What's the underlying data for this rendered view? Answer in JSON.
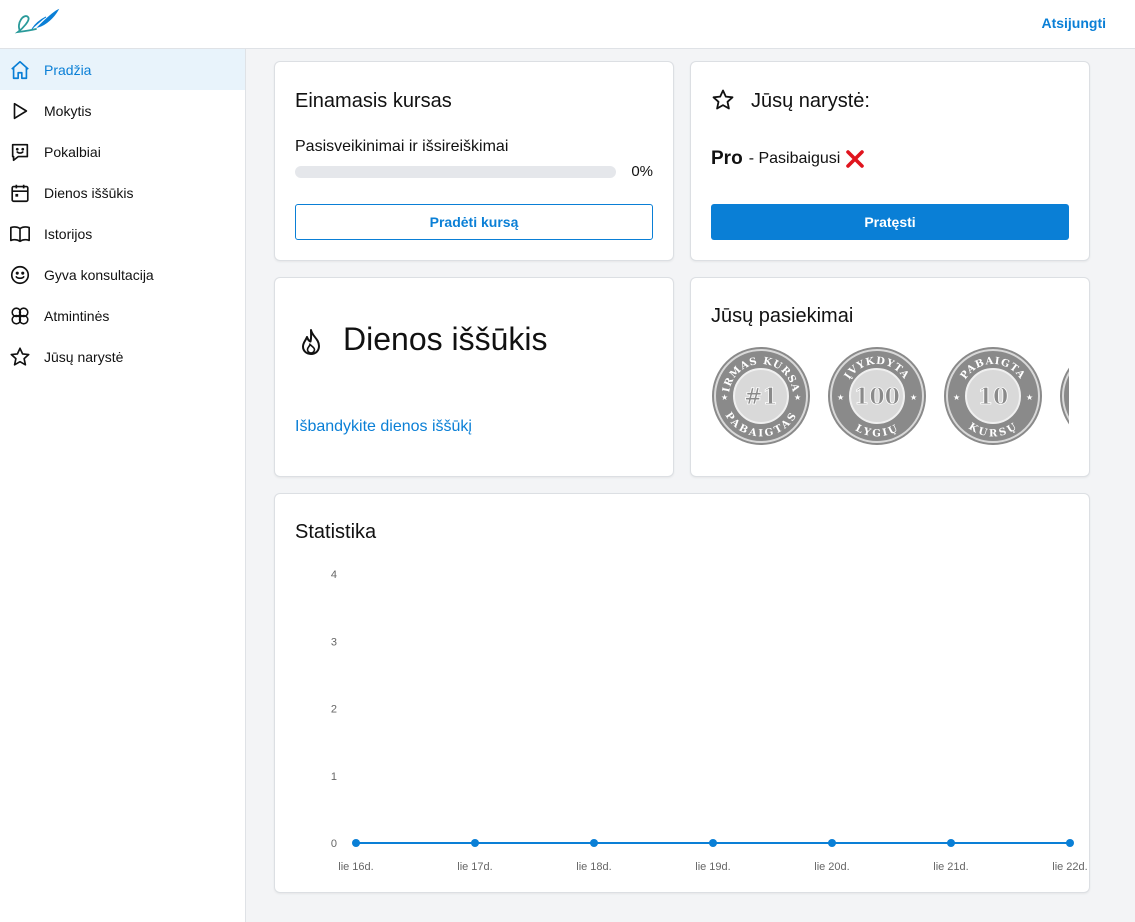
{
  "header": {
    "logout_label": "Atsijungti"
  },
  "sidebar": {
    "items": [
      {
        "label": "Pradžia",
        "icon": "home-icon",
        "active": true
      },
      {
        "label": "Mokytis",
        "icon": "play-icon"
      },
      {
        "label": "Pokalbiai",
        "icon": "chat-icon"
      },
      {
        "label": "Dienos iššūkis",
        "icon": "calendar-icon"
      },
      {
        "label": "Istorijos",
        "icon": "book-icon"
      },
      {
        "label": "Gyva konsultacija",
        "icon": "smiley-icon"
      },
      {
        "label": "Atmintinės",
        "icon": "brain-icon"
      },
      {
        "label": "Jūsų narystė",
        "icon": "star-icon"
      }
    ]
  },
  "course": {
    "title": "Einamasis kursas",
    "name": "Pasisveikinimai ir išsireiškimai",
    "progress": 0,
    "progress_text": "0%",
    "button": "Pradėti kursą"
  },
  "membership": {
    "title": "Jūsų narystė:",
    "plan": "Pro",
    "status": "- Pasibaigusi",
    "button": "Pratęsti"
  },
  "daily": {
    "title": "Dienos iššūkis",
    "link": "Išbandykite dienos iššūkį"
  },
  "achievements": {
    "title": "Jūsų pasiekimai",
    "badges": [
      {
        "top": "PIRMAS KURSAS",
        "center": "#1",
        "bottom": "PABAIGTAS"
      },
      {
        "top": "ĮVYKDYTA",
        "center": "100",
        "bottom": "LYGIŲ"
      },
      {
        "top": "PABAIGTA",
        "center": "10",
        "bottom": "KURSŲ"
      },
      {
        "top": "",
        "center": "",
        "bottom": ""
      }
    ]
  },
  "stats": {
    "title": "Statistika"
  },
  "colors": {
    "accent": "#0a7fd6",
    "badge_gray": "#8a8a8a"
  },
  "chart_data": {
    "type": "line",
    "title": "Statistika",
    "categories": [
      "lie 16d.",
      "lie 17d.",
      "lie 18d.",
      "lie 19d.",
      "lie 20d.",
      "lie 21d.",
      "lie 22d."
    ],
    "values": [
      0,
      0,
      0,
      0,
      0,
      0,
      0
    ],
    "yticks": [
      "0",
      "1",
      "2",
      "3",
      "4"
    ],
    "ylim": [
      0,
      4
    ],
    "grid": false,
    "legend": "none"
  }
}
